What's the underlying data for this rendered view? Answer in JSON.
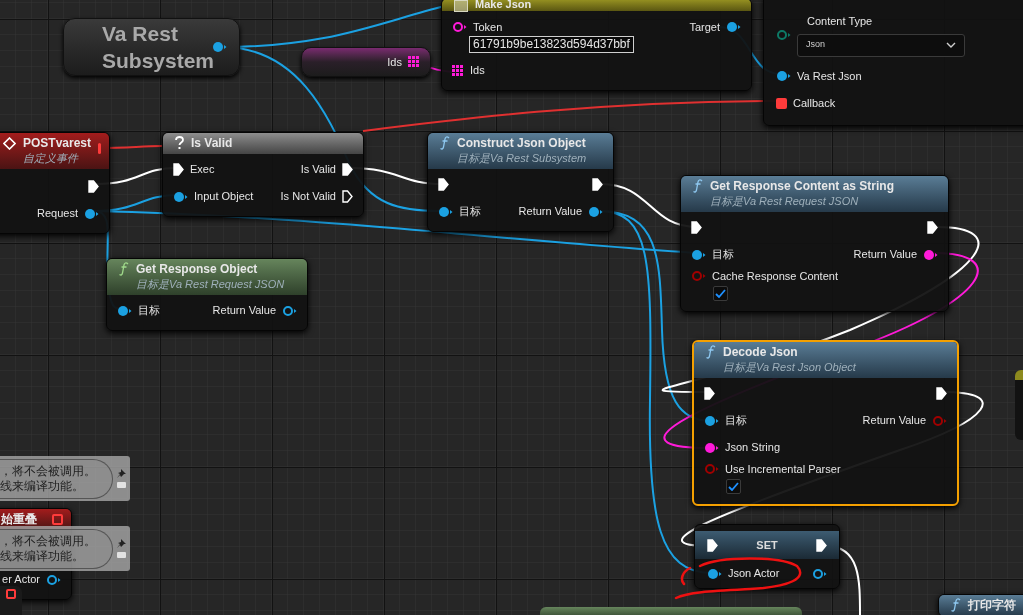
{
  "nodes": [
    {
      "kind": "variable",
      "title": "Va Rest Subsystem",
      "outputs": [
        {
          "kind": "object",
          "connected": true
        }
      ]
    },
    {
      "kind": "array_variable",
      "title": "Ids",
      "outputs": [
        {
          "kind": "array",
          "connected": true
        }
      ]
    },
    {
      "kind": "make",
      "title": "Make Json",
      "selected": false,
      "inputs": [
        {
          "kind": "string",
          "label": "Token",
          "value": "61791b9be13823d594d37bbf",
          "connected": false
        },
        {
          "kind": "array",
          "label": "Ids",
          "connected": true
        }
      ],
      "outputs": [
        {
          "kind": "object",
          "label": "Target",
          "connected": true
        }
      ]
    },
    {
      "kind": "headless",
      "inputs": [
        {
          "kind": "enum",
          "label": "Content Type",
          "value": "Json",
          "connected": false
        },
        {
          "kind": "object",
          "label": "Va Rest Json",
          "connected": true
        },
        {
          "kind": "delegate",
          "label": "Callback",
          "connected": true
        }
      ]
    },
    {
      "kind": "event",
      "title": "POSTvarest",
      "subtitle": "自定义事件",
      "selected": false,
      "outputs": [
        {
          "kind": "exec",
          "connected": true
        },
        {
          "kind": "object",
          "label": "Request",
          "connected": true
        }
      ]
    },
    {
      "kind": "macro",
      "title": "Is Valid",
      "selected": false,
      "inputs": [
        {
          "kind": "exec",
          "label": "Exec",
          "connected": true
        },
        {
          "kind": "object",
          "label": "Input Object",
          "connected": true
        }
      ],
      "outputs": [
        {
          "kind": "exec",
          "label": "Is Valid",
          "connected": true
        },
        {
          "kind": "exec",
          "label": "Is Not Valid",
          "connected": false
        }
      ]
    },
    {
      "kind": "function",
      "title": "Construct Json Object",
      "subtitle": "目标是Va Rest Subsystem",
      "selected": false,
      "inputs": [
        {
          "kind": "exec",
          "connected": true
        },
        {
          "kind": "object",
          "label": "目标",
          "connected": true
        }
      ],
      "outputs": [
        {
          "kind": "exec",
          "connected": true
        },
        {
          "kind": "object",
          "label": "Return Value",
          "connected": true
        }
      ]
    },
    {
      "kind": "pure",
      "title": "Get Response Object",
      "subtitle": "目标是Va Rest Request JSON",
      "selected": false,
      "inputs": [
        {
          "kind": "object",
          "label": "目标",
          "connected": true
        }
      ],
      "outputs": [
        {
          "kind": "object",
          "label": "Return Value",
          "connected": false
        }
      ]
    },
    {
      "kind": "function",
      "title": "Get Response Content as String",
      "subtitle": "目标是Va Rest Request JSON",
      "selected": false,
      "inputs": [
        {
          "kind": "exec",
          "connected": true
        },
        {
          "kind": "object",
          "label": "目标",
          "connected": true
        },
        {
          "kind": "bool",
          "label": "Cache Response Content",
          "checked": true,
          "connected": false
        }
      ],
      "outputs": [
        {
          "kind": "exec",
          "connected": true
        },
        {
          "kind": "string",
          "label": "Return Value",
          "connected": true
        }
      ]
    },
    {
      "kind": "function",
      "title": "Decode Json",
      "subtitle": "目标是Va Rest Json Object",
      "selected": true,
      "inputs": [
        {
          "kind": "exec",
          "connected": true
        },
        {
          "kind": "object",
          "label": "目标",
          "connected": true
        },
        {
          "kind": "string",
          "label": "Json String",
          "connected": true
        },
        {
          "kind": "bool",
          "label": "Use Incremental Parser",
          "checked": true,
          "connected": false
        }
      ],
      "outputs": [
        {
          "kind": "exec",
          "connected": true
        },
        {
          "kind": "bool",
          "label": "Return Value",
          "connected": false
        }
      ]
    },
    {
      "kind": "set",
      "title": "SET",
      "selected": false,
      "inputs": [
        {
          "kind": "exec",
          "connected": true
        },
        {
          "kind": "object",
          "label": "Json Actor",
          "connected": true
        }
      ],
      "outputs": [
        {
          "kind": "exec",
          "connected": true
        },
        {
          "kind": "object",
          "connected": false
        }
      ]
    },
    {
      "kind": "comment",
      "lines": [
        "，将不会被调用。",
        "线来编译功能。"
      ]
    },
    {
      "kind": "event",
      "title": "始重叠",
      "selected": false,
      "outputs": [
        {
          "kind": "object",
          "label": "er Actor",
          "connected": false
        }
      ]
    },
    {
      "kind": "comment",
      "lines": [
        "，将不会被调用。",
        "线来编译功能。"
      ]
    },
    {
      "kind": "function",
      "title": "打印字符",
      "selected": false
    }
  ]
}
